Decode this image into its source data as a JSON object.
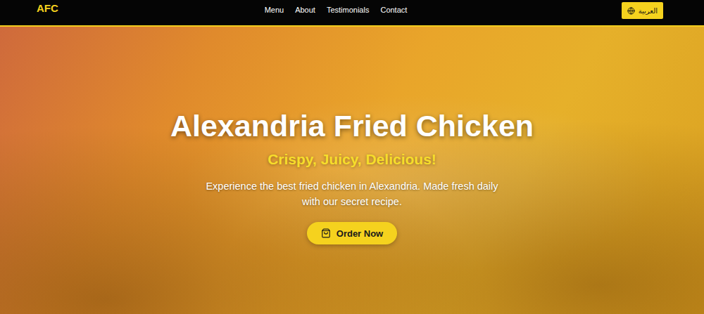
{
  "nav": {
    "logo": "AFC",
    "links": [
      "Menu",
      "About",
      "Testimonials",
      "Contact"
    ],
    "language_button": "العربية"
  },
  "hero": {
    "title": "Alexandria Fried Chicken",
    "subtitle": "Crispy, Juicy, Delicious!",
    "description": "Experience the best fried chicken in Alexandria. Made fresh daily with our secret recipe.",
    "cta": "Order Now"
  }
}
